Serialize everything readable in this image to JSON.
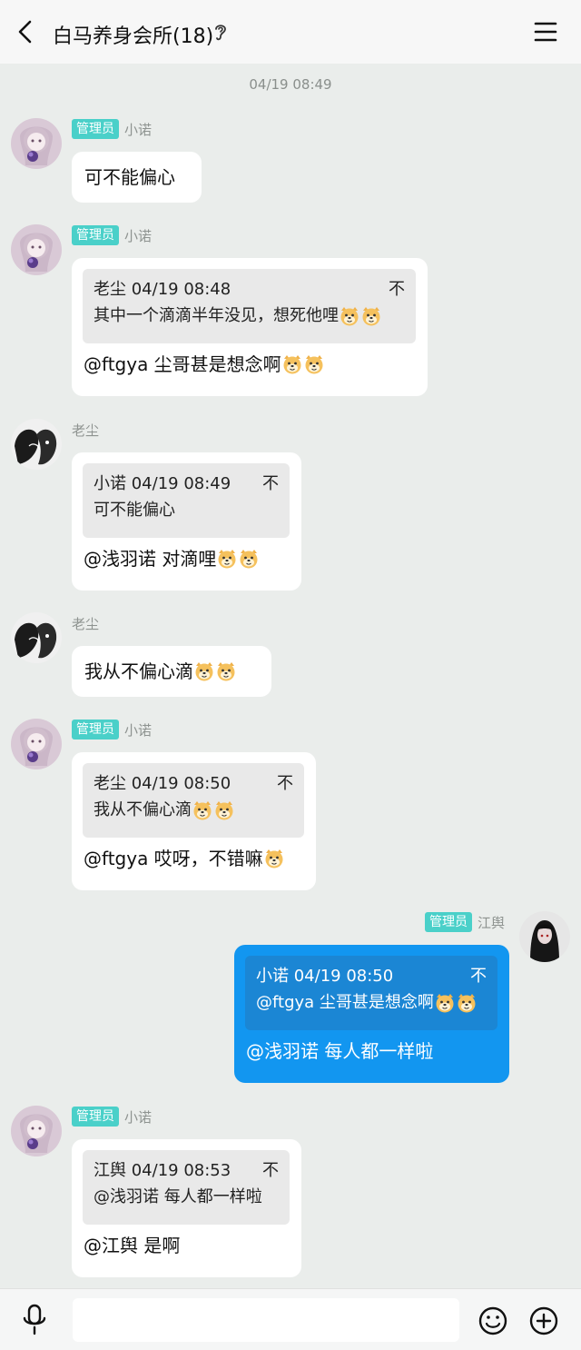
{
  "header": {
    "title": "白马养身会所(18)",
    "back_icon": "chevron-left-icon",
    "menu_icon": "hamburger-icon",
    "ear_icon": "ear-icon"
  },
  "chat": {
    "timestamp": "04/19 08:49",
    "messages": [
      {
        "badge": "管理员",
        "nick": "小诺",
        "text": "可不能偏心"
      },
      {
        "badge": "管理员",
        "nick": "小诺",
        "quote_head": "老尘 04/19 08:48",
        "quote_body": "其中一个滴滴半年没见，想死他哩",
        "reply": "@ftgya 尘哥甚是想念啊"
      },
      {
        "nick": "老尘",
        "quote_head": "小诺 04/19 08:49",
        "quote_body": "可不能偏心",
        "reply": "@浅羽诺 对滴哩"
      },
      {
        "nick": "老尘",
        "text": "我从不偏心滴"
      },
      {
        "badge": "管理员",
        "nick": "小诺",
        "quote_head": "老尘 04/19 08:50",
        "quote_body": "我从不偏心滴",
        "reply": "@ftgya 哎呀，不错嘛"
      },
      {
        "badge": "管理员",
        "nick": "江舆",
        "quote_head": "小诺 04/19 08:50",
        "quote_body": "@ftgya 尘哥甚是想念啊",
        "reply": "@浅羽诺 每人都一样啦"
      },
      {
        "badge": "管理员",
        "nick": "小诺",
        "quote_head": "江舆 04/19 08:53",
        "quote_body": "@浅羽诺 每人都一样啦",
        "reply": "@江舆 是啊"
      }
    ],
    "pin_glyph": "不"
  },
  "input": {
    "value": "",
    "placeholder": ""
  },
  "colors": {
    "accent": "#1296f0",
    "badge": "#4ad0c9",
    "background": "#eaedeb"
  }
}
